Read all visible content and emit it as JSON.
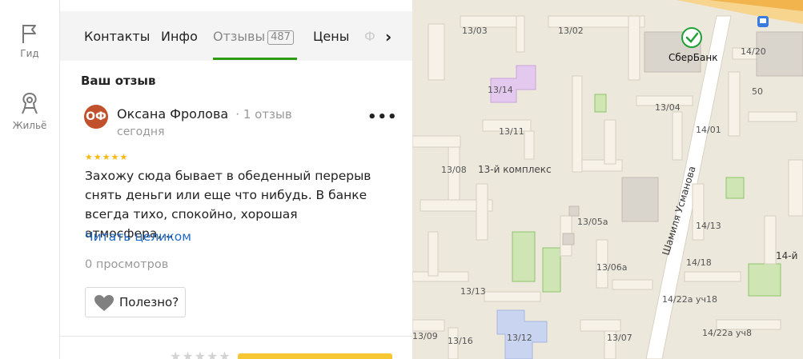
{
  "rail": {
    "items": [
      {
        "label": "Гид",
        "icon": "flag-icon"
      },
      {
        "label": "Жильё",
        "icon": "home-search-icon"
      }
    ]
  },
  "tabs": {
    "items": [
      {
        "label": "Контакты"
      },
      {
        "label": "Инфо"
      },
      {
        "label": "Отзывы",
        "count": "487",
        "active": true
      },
      {
        "label": "Цены"
      },
      {
        "label": "Ф"
      }
    ]
  },
  "review_section": {
    "title": "Ваш отзыв",
    "author": {
      "initials": "ОФ",
      "name": "Оксана Фролова",
      "meta": "· 1 отзыв",
      "date": "сегодня"
    },
    "rating": 5,
    "stars": "★★★★★",
    "text": "Захожу сюда бывает в обеденный перерыв снять деньги или еще что нибудь. В банке всегда тихо, спокойно, хорошая атмосфера,…",
    "read_more": "Читать целиком",
    "views": "0 просмотров",
    "useful_label": "Полезно?",
    "more_label": "•••"
  },
  "bottom": {
    "stars": "★★★★★"
  },
  "map": {
    "labels": [
      "13/03",
      "13/02",
      "13/14",
      "13/04",
      "13/11",
      "13/08",
      "13-й комплекс",
      "13/05а",
      "13/06а",
      "13/13",
      "13/12",
      "13/16",
      "13/09",
      "13/07",
      "14/20",
      "14/01",
      "14/13",
      "14/18",
      "14/22а уч18",
      "14/22а уч8",
      "14-й",
      "50",
      "Шамиля Усманова"
    ],
    "poi": {
      "name": "СберБанк",
      "icon": "sberbank-logo-icon",
      "color": "#21a038"
    }
  },
  "colors": {
    "accent_green": "#2b9c13",
    "link": "#1f69c9",
    "star": "#fbb80f",
    "avatar": "#c0512c"
  }
}
